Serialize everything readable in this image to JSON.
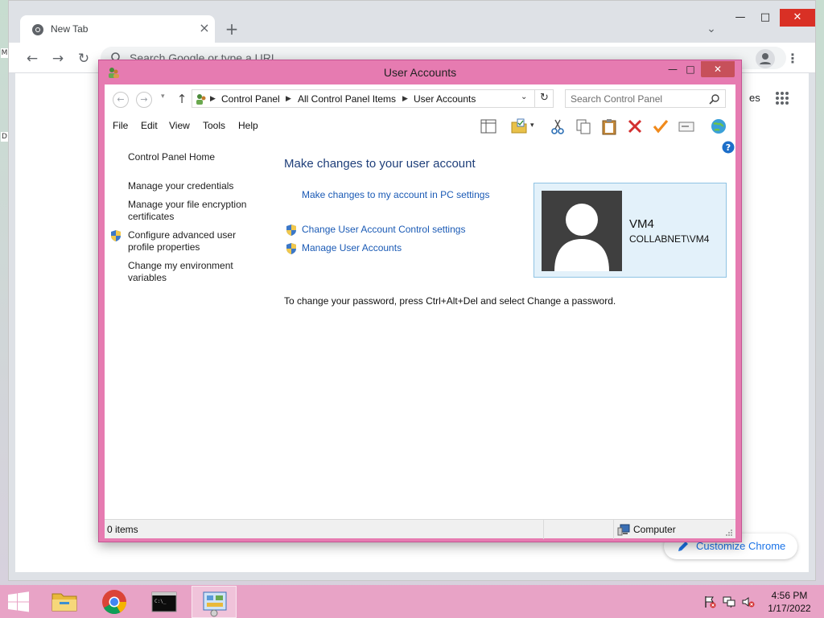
{
  "desktop": {
    "edge_glyph_top": "M",
    "edge_glyph_bottom": "D"
  },
  "chrome": {
    "tab_title": "New Tab",
    "tab_close": "×",
    "new_tab": "+",
    "tab_search": "⌄",
    "minimize": "—",
    "maximize": "□",
    "close": "✕",
    "back": "←",
    "forward": "→",
    "reload": "↻",
    "omnibox_placeholder": "Search Google or type a URL",
    "menu": "⋮",
    "page_link_partial": "es",
    "customize_label": "Customize Chrome"
  },
  "window": {
    "title": "User Accounts",
    "minimize": "—",
    "maximize": "□",
    "close": "✕"
  },
  "address": {
    "back": "←",
    "forward": "→",
    "recent": "▾",
    "up": "↑",
    "crumbs": [
      "Control Panel",
      "All Control Panel Items",
      "User Accounts"
    ],
    "separator": "▶",
    "dropdown": "⌄",
    "refresh": "↻",
    "search_placeholder": "Search Control Panel"
  },
  "menu": [
    "File",
    "Edit",
    "View",
    "Tools",
    "Help"
  ],
  "toolbar_icons": [
    "layout-pane-icon",
    "folder-view-icon",
    "cut-icon",
    "copy-icon",
    "paste-icon",
    "delete-icon",
    "checkmark-icon",
    "properties-icon",
    "globe-icon"
  ],
  "toolbar_dropdown": "▾",
  "left_tasks": [
    {
      "label": "Control Panel Home",
      "shield": false
    },
    {
      "label": "Manage your credentials",
      "shield": false
    },
    {
      "label": "Manage your file encryption certificates",
      "shield": false
    },
    {
      "label": "Configure advanced user profile properties",
      "shield": true
    },
    {
      "label": "Change my environment variables",
      "shield": false
    }
  ],
  "main": {
    "title": "Make changes to your user account",
    "link_pc_settings": "Make changes to my account in PC settings",
    "link_uac": "Change User Account Control settings",
    "link_manage": "Manage User Accounts",
    "password_note": "To change your password, press Ctrl+Alt+Del and select Change a password."
  },
  "user": {
    "name": "VM4",
    "domain": "COLLABNET\\VM4"
  },
  "status": {
    "items": "0 items",
    "location": "Computer"
  },
  "taskbar": {
    "apps": [
      "file-explorer",
      "chrome",
      "command-prompt",
      "control-panel"
    ],
    "time": "4:56 PM",
    "date": "1/17/2022"
  },
  "colors": {
    "window_frame": "#e67bb1",
    "taskbar": "#e8a3c6",
    "title_blue": "#1f3f7a",
    "link_blue": "#1a5ab5",
    "chrome_blue": "#1a73e8",
    "tile_bg": "#e3f1fa"
  }
}
